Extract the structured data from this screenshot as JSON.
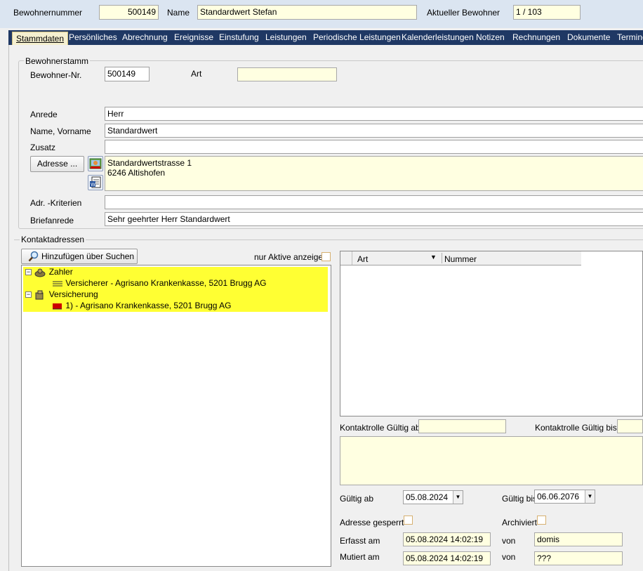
{
  "header": {
    "bewohnernummer_label": "Bewohnernummer",
    "bewohnernummer_value": "500149",
    "name_label": "Name",
    "name_value": "Standardwert Stefan",
    "aktueller_label": "Aktueller Bewohner",
    "aktueller_value": "1 / 103"
  },
  "tabs": [
    {
      "label": "Stammdaten",
      "active": true
    },
    {
      "label": "Persönliches"
    },
    {
      "label": "Abrechnung"
    },
    {
      "label": "Ereignisse"
    },
    {
      "label": "Einstufung"
    },
    {
      "label": "Leistungen"
    },
    {
      "label": "Periodische Leistungen"
    },
    {
      "label": "Kalenderleistungen"
    },
    {
      "label": "Notizen"
    },
    {
      "label": "Rechnungen"
    },
    {
      "label": "Dokumente"
    },
    {
      "label": "Termine"
    }
  ],
  "stamm": {
    "group_title": "Bewohnerstamm",
    "nr_label": "Bewohner-Nr.",
    "nr_value": "500149",
    "art_label": "Art",
    "art_value": "",
    "anrede_label": "Anrede",
    "anrede_value": "Herr",
    "name_label": "Name, Vorname",
    "name_value": "Standardwert",
    "zusatz_label": "Zusatz",
    "zusatz_value": "",
    "adresse_button": "Adresse ...",
    "adresse_line1": "Standardwertstrasse 1",
    "adresse_line2": "6246 Altishofen",
    "kriterien_label": "Adr. -Kriterien",
    "kriterien_value": "",
    "briefanrede_label": "Briefanrede",
    "briefanrede_value": "Sehr geehrter Herr Standardwert"
  },
  "kontakt": {
    "section_title": "Kontaktadressen",
    "add_button": "Hinzufügen über Suchen",
    "nur_aktive_label": "nur Aktive anzeigen",
    "tree": [
      {
        "label": "Zahler",
        "icon": "payer-icon",
        "children": [
          {
            "label": "Versicherer - Agrisano Krankenkasse, 5201 Brugg AG",
            "icon": "card-icon"
          }
        ]
      },
      {
        "label": "Versicherung",
        "icon": "insurance-icon",
        "children": [
          {
            "label": "1) - Agrisano Krankenkasse, 5201 Brugg AG",
            "icon": "red-flag-icon"
          }
        ]
      }
    ],
    "grid_columns": [
      "Art",
      "Nummer"
    ],
    "gueltig_ab_label": "Kontaktrolle Gültig ab",
    "gueltig_ab_value": "",
    "gueltig_bis_label": "Kontaktrolle Gültig bis",
    "gueltig_bis_value": "",
    "gueltig_ab2_label": "Gültig ab",
    "gueltig_ab2_value": "05.08.2024",
    "gueltig_bis2_label": "Gültig bis",
    "gueltig_bis2_value": "06.06.2076",
    "gesperrt_label": "Adresse gesperrt",
    "archiviert_label": "Archiviert",
    "erfasst_label": "Erfasst am",
    "erfasst_value": "05.08.2024 14:02:19",
    "erfasst_von_label": "von",
    "erfasst_von_value": "domis",
    "mutiert_label": "Mutiert am",
    "mutiert_value": "05.08.2024 14:02:19",
    "mutiert_von_label": "von",
    "mutiert_von_value": "???"
  }
}
